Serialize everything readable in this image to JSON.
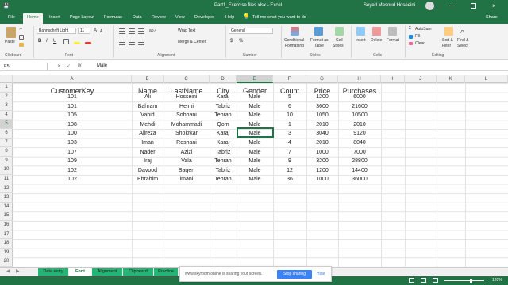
{
  "titlebar": {
    "quick_save": "💾",
    "title": "Part1_Exercise files.xlsx  -  Excel",
    "user": "Seyed Masoud Hoseeini"
  },
  "tabs": [
    "File",
    "Home",
    "Insert",
    "Page Layout",
    "Formulas",
    "Data",
    "Review",
    "View",
    "Developer",
    "Help"
  ],
  "tell_me": "Tell me what you want to do",
  "share": "Share",
  "ribbon": {
    "clipboard": {
      "label": "Clipboard",
      "paste": "Paste"
    },
    "font": {
      "label": "Font",
      "name": "Bahnschrift Light",
      "size": "11",
      "bold": "B",
      "italic": "I",
      "underline": "U"
    },
    "alignment": {
      "label": "Alignment",
      "wrap": "Wrap Text",
      "merge": "Merge & Center"
    },
    "number": {
      "label": "Number",
      "format": "General",
      "currency": "$",
      "percent": "%"
    },
    "styles": {
      "label": "Styles",
      "conditional": "Conditional",
      "conditional2": "Formatting",
      "format_as": "Format as",
      "format_as2": "Table",
      "cell": "Cell",
      "cell2": "Styles"
    },
    "cells": {
      "label": "Cells",
      "insert": "Insert",
      "delete": "Delete",
      "format": "Format"
    },
    "editing": {
      "label": "Editing",
      "autosum": "AutoSum",
      "fill": "Fill",
      "clear": "Clear",
      "sort": "Sort &",
      "sort2": "Filter",
      "find": "Find &",
      "find2": "Select"
    }
  },
  "formula_bar": {
    "name_box": "E5",
    "fx": "fx",
    "value": "Male"
  },
  "columns": [
    "A",
    "B",
    "C",
    "D",
    "E",
    "F",
    "G",
    "H",
    "I",
    "J",
    "K",
    "L"
  ],
  "rows": [
    "1",
    "2",
    "3",
    "4",
    "5",
    "6",
    "7",
    "8",
    "9",
    "10",
    "11",
    "12",
    "13",
    "14",
    "15",
    "16",
    "17",
    "18",
    "19",
    "20"
  ],
  "table": {
    "headers": [
      "CustomerKey",
      "Name",
      "LastName",
      "City",
      "Gender",
      "Count",
      "Price",
      "Purchases"
    ],
    "rows": [
      [
        "101",
        "Ali",
        "Hosseini",
        "Karaj",
        "Male",
        "5",
        "1200",
        "6000"
      ],
      [
        "101",
        "Bahram",
        "Helmi",
        "Tabriz",
        "Male",
        "6",
        "3600",
        "21600"
      ],
      [
        "105",
        "Vahid",
        "Sobhani",
        "Tehran",
        "Male",
        "10",
        "1050",
        "10500"
      ],
      [
        "108",
        "Mehdi",
        "Mohammadi",
        "Qom",
        "Male",
        "1",
        "2010",
        "2010"
      ],
      [
        "100",
        "Alireza",
        "Shokrkar",
        "Karaj",
        "Male",
        "3",
        "3040",
        "9120"
      ],
      [
        "103",
        "Iman",
        "Roshani",
        "Karaj",
        "Male",
        "4",
        "2010",
        "8040"
      ],
      [
        "107",
        "Nader",
        "Azizi",
        "Tabriz",
        "Male",
        "7",
        "1000",
        "7000"
      ],
      [
        "109",
        "Iraj",
        "Vala",
        "Tehran",
        "Male",
        "9",
        "3200",
        "28800"
      ],
      [
        "102",
        "Davood",
        "Baqeri",
        "Tabriz",
        "Male",
        "12",
        "1200",
        "14400"
      ],
      [
        "102",
        "Ebrahim",
        "imani",
        "Tehran",
        "Male",
        "36",
        "1000",
        "36000"
      ]
    ]
  },
  "sheets": [
    "Data entry",
    "Font",
    "Alignment",
    "Clipboard",
    "Practice"
  ],
  "active_sheet": "Font",
  "share_bar": {
    "message": "www.skyroom.online is sharing your screen.",
    "stop": "Stop sharing",
    "hide": "Hide"
  },
  "zoom": "120%",
  "colors": {
    "excel_green": "#217346",
    "sheet_tab": "#22b573",
    "selection": "#217346"
  }
}
